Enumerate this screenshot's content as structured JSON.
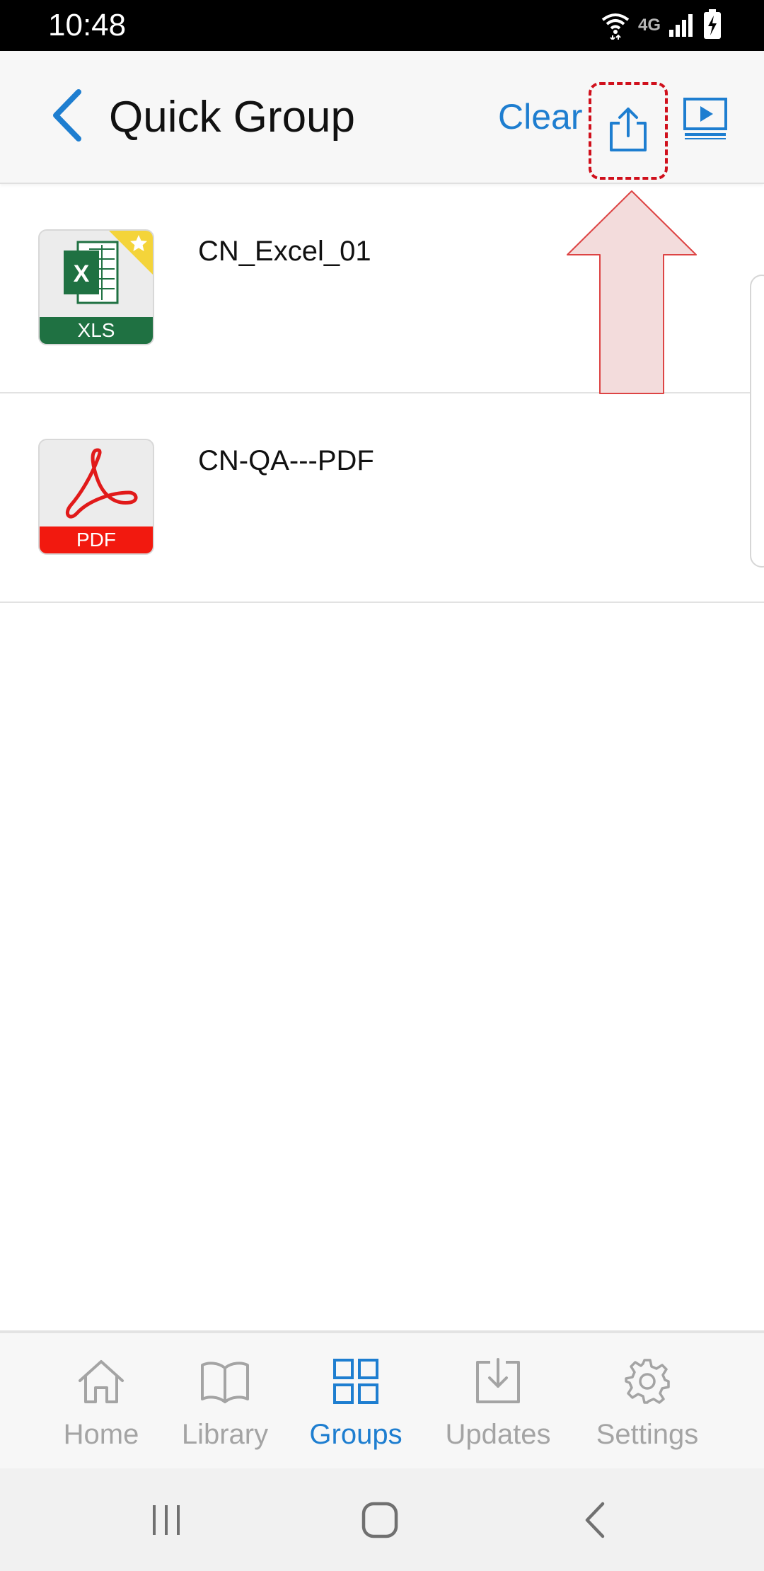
{
  "status_bar": {
    "time": "10:48",
    "network_label": "4G",
    "icons": [
      "wifi-icon",
      "signal-icon",
      "battery-charging-icon"
    ]
  },
  "header": {
    "title": "Quick Group",
    "clear_label": "Clear",
    "icons": [
      "back-chevron-icon",
      "share-icon",
      "present-icon"
    ]
  },
  "files": [
    {
      "name": "CN_Excel_01",
      "type_label": "XLS",
      "favorite": true,
      "band_color": "#1f7142"
    },
    {
      "name": "CN-QA---PDF",
      "type_label": "PDF",
      "favorite": false,
      "band_color": "#f2190f"
    }
  ],
  "bottom_nav": {
    "items": [
      {
        "label": "Home",
        "icon": "home-icon",
        "active": false
      },
      {
        "label": "Library",
        "icon": "book-icon",
        "active": false
      },
      {
        "label": "Groups",
        "icon": "grid-icon",
        "active": true
      },
      {
        "label": "Updates",
        "icon": "download-tray-icon",
        "active": false
      },
      {
        "label": "Settings",
        "icon": "gear-icon",
        "active": false
      }
    ]
  },
  "system_nav": {
    "icons": [
      "recents-icon",
      "home-button-icon",
      "back-icon"
    ]
  },
  "colors": {
    "accent": "#1e7ed0",
    "inactive": "#a4a4a4",
    "highlight": "#d0101c"
  }
}
